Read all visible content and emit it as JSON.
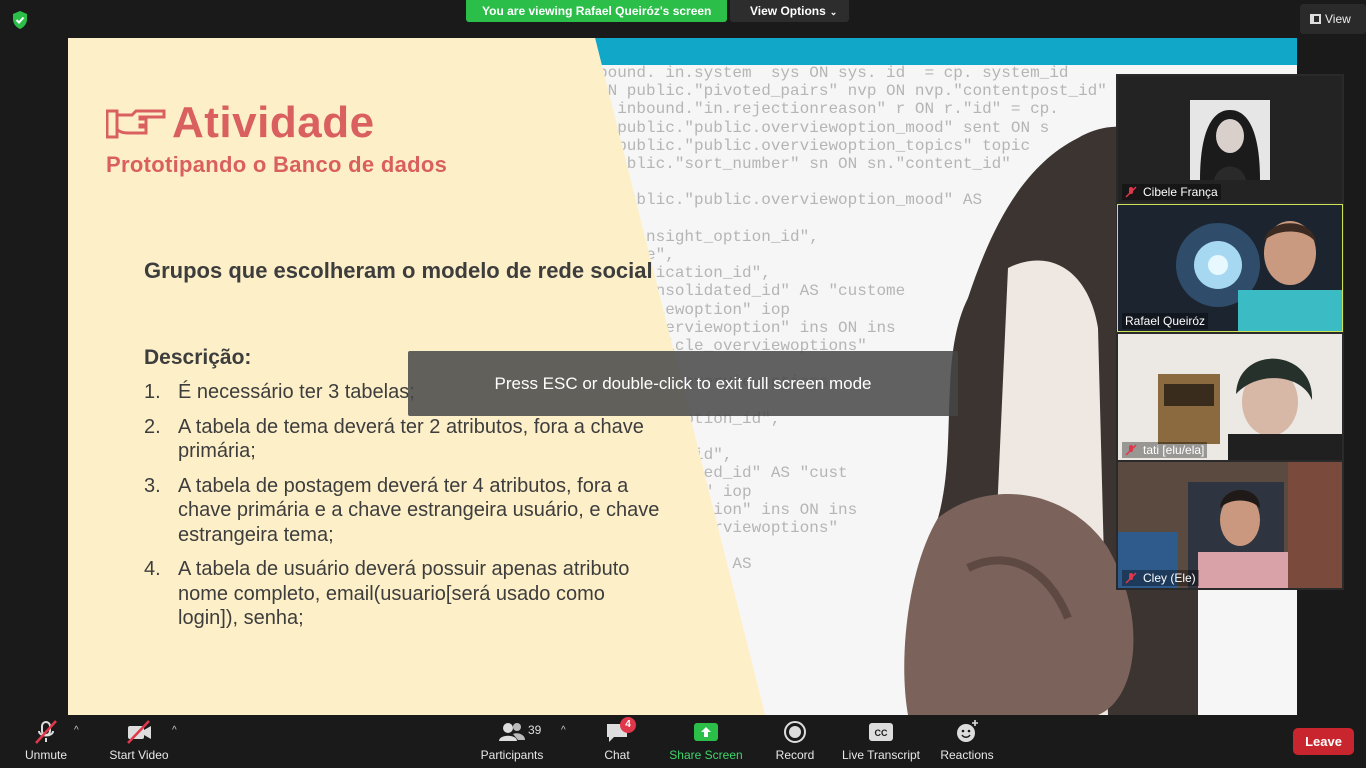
{
  "top_bar": {
    "viewing_banner": "You are viewing Rafael Queiróz's screen",
    "view_options": "View Options",
    "view_button": "View"
  },
  "slide": {
    "title": "Atividade",
    "subtitle": "Prototipando o Banco de dados",
    "group_heading": "Grupos que escolheram o modelo de rede social",
    "description_heading": "Descrição:",
    "items": [
      {
        "num": "1.",
        "text": "É necessário ter 3 tabelas;"
      },
      {
        "num": "2.",
        "text": "A tabela de tema deverá ter 2 atributos, fora a chave primária;"
      },
      {
        "num": "3.",
        "text": "A tabela de postagem deverá ter  4 atributos, fora a chave primária e a chave estrangeira usuário, e chave estrangeira tema;"
      },
      {
        "num": "4.",
        "text": "A tabela de usuário deverá possuir apenas atributo nome completo, email(usuario[será usado como login]), senha;"
      }
    ],
    "code_text": "bound. in.system  sys ON sys. id  = cp. system_id\n N public.\"pivoted_pairs\" nvp ON nvp.\"contentpost_id\"\n  inbound.\"in.rejectionreason\" r ON r.\"id\" = cp.\n  public.\"public.overviewoption_mood\" sent ON s\n  public.\"public.overviewoption_topics\" topic\n public.\"sort_number\" sn ON sn.\"content_id\"\n\nE public.\"public.overviewoption_mood\" AS\n\nAS \"insight_option_id\",\n  name\",\n  application_id\",\n  r_consolidated_id\" AS \"custome\n  verviewoption\" iop\n  in.overviewoption\" ins ON ins\n  n.article_overviewoptions\"\n\n  public.overviewoptions\n\n  sight_option_id\",\n\n  ication_id\",\n  onsolidated_id\" AS \"cust\n  iewoption\" iop\n  verviewoption\" ins ON ins\n  rticle_overviewoptions\"\n\n  \"positives\" AS\n\n\n  tives\"\n  jects\"\n  tent_id\"\n\n  e"
  },
  "fullscreen_toast": "Press ESC or double-click to exit full screen mode",
  "participants": [
    {
      "name": "Cibele França",
      "muted": true,
      "active": false
    },
    {
      "name": "Rafael Queiróz",
      "muted": false,
      "active": true
    },
    {
      "name": "tati [elu/ela]",
      "muted": true,
      "active": false
    },
    {
      "name": "Cley (Ele)",
      "muted": true,
      "active": false
    }
  ],
  "toolbar": {
    "unmute": "Unmute",
    "start_video": "Start Video",
    "participants": "Participants",
    "participants_count": "39",
    "chat": "Chat",
    "chat_badge": "4",
    "share_screen": "Share Screen",
    "record": "Record",
    "live_transcript": "Live Transcript",
    "reactions": "Reactions",
    "leave": "Leave"
  },
  "colors": {
    "accent_green": "#2bbf4a",
    "slide_title": "#d9605f",
    "slide_bg": "#fdf0c8",
    "leave_red": "#c9252f",
    "active_speaker": "#cde254"
  }
}
